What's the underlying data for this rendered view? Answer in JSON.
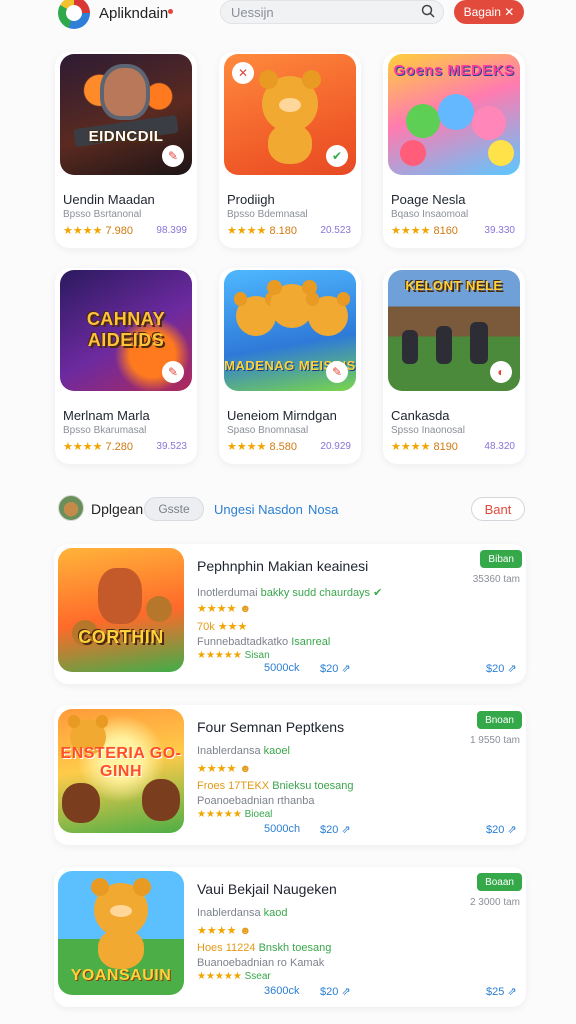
{
  "header": {
    "app_name": "Aplikndain",
    "search_placeholder": "Uessijn",
    "signin_label": "Bagain ✕"
  },
  "grid_cards": [
    {
      "art_title": "EIDNCDIL",
      "title": "Uendin Maadan",
      "subtitle": "Bpsso Bsrtanonal",
      "rating": "7.980",
      "count": "98.399",
      "badge_icon": "check"
    },
    {
      "art_title": "",
      "title": "Prodiigh",
      "subtitle": "Bpsso Bdemnasal",
      "rating": "8.180",
      "count": "20.523",
      "badge_icon": "check"
    },
    {
      "art_title": "Goens MEDEKS",
      "title": "Poage Nesla",
      "subtitle": "Bqaso Insaomoal",
      "rating": "8160",
      "count": "39.330",
      "badge_icon": ""
    },
    {
      "art_title": "CAHNAY AIDEIDS",
      "title": "Merlnam Marla",
      "subtitle": "Bpsso Bkarumasal",
      "rating": "7.280",
      "count": "39.523",
      "badge_icon": ""
    },
    {
      "art_title": "MADENAG MEISINS",
      "title": "Ueneiom Mirndgan",
      "subtitle": "Spaso Bnomnasal",
      "rating": "8.580",
      "count": "20.929",
      "badge_icon": ""
    },
    {
      "art_title": "KELONT NELE",
      "title": "Cankasda",
      "subtitle": "Spsso Inaonosal",
      "rating": "8190",
      "count": "48.320",
      "badge_icon": ""
    }
  ],
  "filters": {
    "label": "Dplgean",
    "active_chip": "Gsste",
    "link1": "Ungesi Nasdon",
    "link2": "Nosa",
    "button": "Bant"
  },
  "list_items": [
    {
      "art_title": "CORTHIN",
      "title": "Pephnphin Makian keainesi",
      "badge": "Biban",
      "time": "35360 tam",
      "line1_gray": "Inotlerdumai",
      "line1_green": "bakky sudd chaurdays",
      "line2_orange": "70k",
      "line3_gray": "Funnebadtadkatko",
      "line3_green": "Isanreal",
      "line4_green": "Sisan",
      "foot1": "5000ck",
      "foot2": "$20",
      "foot3": "$20"
    },
    {
      "art_title": "ENSTERIA GO-GINH",
      "title": "Four Semnan Peptkens",
      "badge": "Bnoan",
      "time": "1 9550 tam",
      "line1_gray": "Inablerdansa",
      "line1_green": "kaoel",
      "line2_orange": "Froes 17TEKX",
      "line2_green": "Bnieksu toesang",
      "line3_gray": "Poanoebadnian",
      "line3_green": "rthanba",
      "line4_green": "Bioeal",
      "foot1": "5000ch",
      "foot2": "$20",
      "foot3": "$20"
    },
    {
      "art_title": "YOANSAUIN",
      "title": "Vaui Bekjail Naugeken",
      "badge": "Boaan",
      "time": "2 3000 tam",
      "line1_gray": "Inablerdansa",
      "line1_green": "kaod",
      "line2_orange": "Hoes 11224",
      "line2_green": "Bnskh toesang",
      "line3_gray": "Buanoebadnian",
      "line3_green": "ro Kamak",
      "line4_green": "Ssear",
      "foot1": "3600ck",
      "foot2": "$20",
      "foot3": "$25"
    }
  ],
  "colors": {
    "accent": "#e24a3b",
    "link": "#2c7fd3",
    "badge_green": "#35a84a",
    "star": "#f0a500"
  }
}
